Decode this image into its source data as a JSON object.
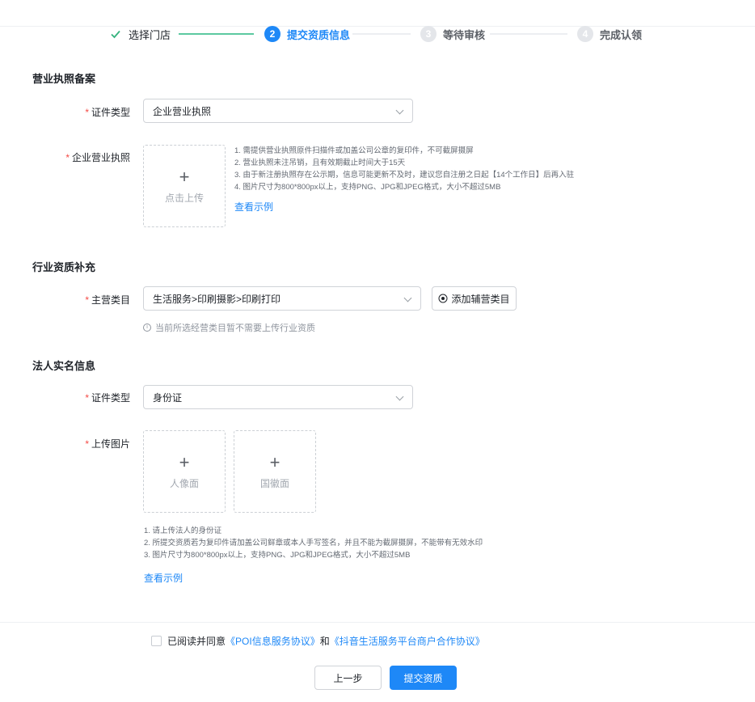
{
  "steps": [
    {
      "number": "1",
      "label": "选择门店",
      "state": "done"
    },
    {
      "number": "2",
      "label": "提交资质信息",
      "state": "active"
    },
    {
      "number": "3",
      "label": "等待审核",
      "state": "wait"
    },
    {
      "number": "4",
      "label": "完成认领",
      "state": "wait"
    }
  ],
  "business_license": {
    "title": "营业执照备案",
    "cert_type_label": "证件类型",
    "cert_type_value": "企业营业执照",
    "license_label": "企业营业执照",
    "upload_text": "点击上传",
    "tips": [
      "1. 需提供营业执照原件扫描件或加盖公司公章的复印件，不可截屏摄屏",
      "2. 营业执照未注吊销，且有效期截止时间大于15天",
      "3. 由于新注册执照存在公示期，信息可能更新不及时，建议您自注册之日起【14个工作日】后再入驻",
      "4. 图片尺寸为800*800px以上，支持PNG、JPG和JPEG格式，大小不超过5MB"
    ],
    "example_link": "查看示例"
  },
  "industry": {
    "title": "行业资质补充",
    "category_label": "主营类目",
    "category_value": "生活服务>印刷摄影>印刷打印",
    "add_button": "添加辅营类目",
    "hint": "当前所选经营类目暂不需要上传行业资质"
  },
  "legal_person": {
    "title": "法人实名信息",
    "cert_type_label": "证件类型",
    "cert_type_value": "身份证",
    "upload_label": "上传图片",
    "portrait_text": "人像面",
    "emblem_text": "国徽面",
    "tips": [
      "1. 请上传法人的身份证",
      "2. 所提交资质若为复印件请加盖公司鲜章或本人手写签名，并且不能为截屏摄屏，不能带有无效水印",
      "3. 图片尺寸为800*800px以上，支持PNG、JPG和JPEG格式，大小不超过5MB"
    ],
    "example_link": "查看示例"
  },
  "agreement": {
    "prefix": "已阅读并同意",
    "link1": "《POI信息服务协议》",
    "conjunction": "和",
    "link2": "《抖音生活服务平台商户合作协议》"
  },
  "footer": {
    "prev_button": "上一步",
    "submit_button": "提交资质"
  },
  "colors": {
    "primary": "#1e88f7",
    "required": "#f54a45",
    "done_check": "#36b37e"
  }
}
